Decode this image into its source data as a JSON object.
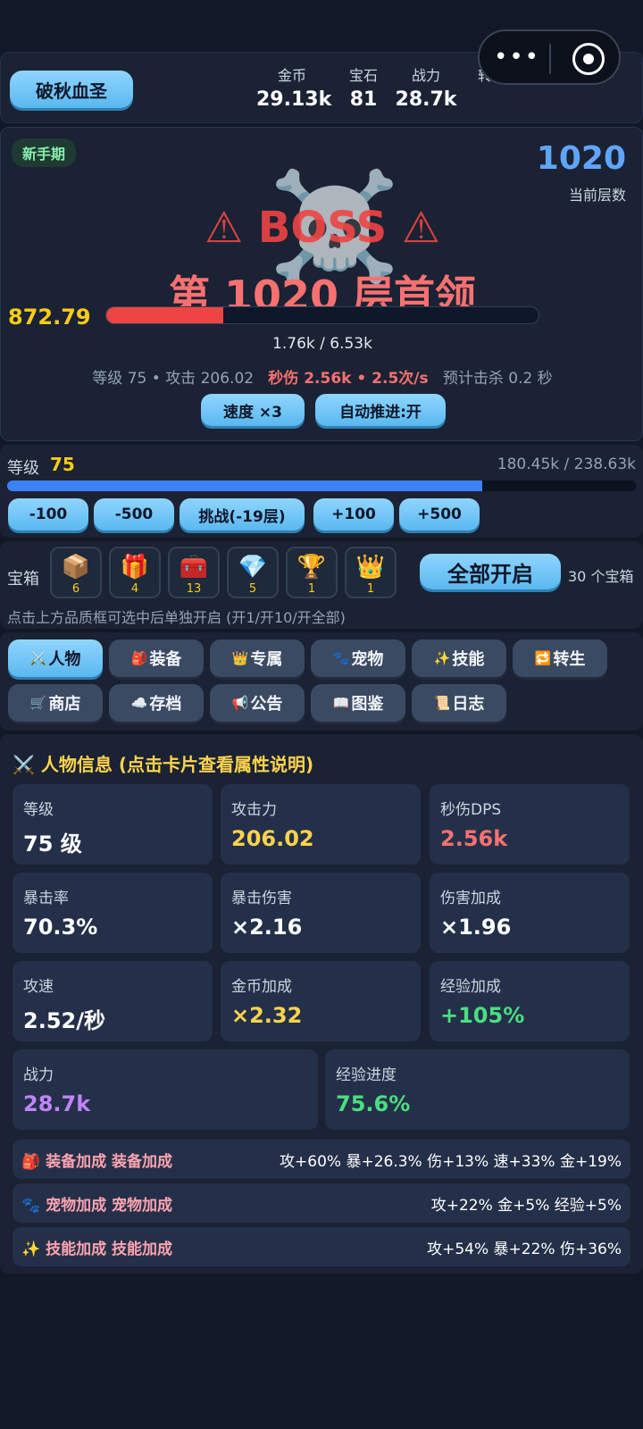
{
  "header": {
    "character_name": "破秋血圣",
    "stats": [
      {
        "label": "金币",
        "value": "29.13k"
      },
      {
        "label": "宝石",
        "value": "81"
      },
      {
        "label": "战力",
        "value": "28.7k"
      },
      {
        "label": "转生点",
        "value": ""
      }
    ]
  },
  "battle": {
    "phase_badge": "新手期",
    "floor_number": "1020",
    "floor_label": "当前层数",
    "boss_banner": "⚠ BOSS ⚠",
    "boss_title": "第 1020 层首领",
    "floating_damage": "872.79",
    "hp_text": "1.76k / 6.53k",
    "hp_fraction": 0.27,
    "info_level": "等级 75",
    "info_sep1": " • ",
    "info_attack": "攻击 206.02",
    "info_dps": "秒伤 2.56k",
    "info_sep2": " • ",
    "info_rate": "2.5次/s",
    "info_kill": "预计击杀 0.2 秒",
    "speed_button": "速度 ×3",
    "auto_button": "自动推进:开"
  },
  "level": {
    "label": "等级",
    "value": "75",
    "exp_text": "180.45k / 238.63k",
    "exp_fraction": 0.756,
    "buttons": [
      "-100",
      "-500",
      "挑战(-19层)",
      "+100",
      "+500"
    ]
  },
  "chests": {
    "label": "宝箱",
    "items": [
      {
        "icon": "📦",
        "icon_name": "crate-icon",
        "count": "6"
      },
      {
        "icon": "🎁",
        "icon_name": "gift-icon",
        "count": "4"
      },
      {
        "icon": "🧰",
        "icon_name": "toolbox-icon",
        "count": "13"
      },
      {
        "icon": "💎",
        "icon_name": "diamond-icon",
        "count": "5"
      },
      {
        "icon": "🏆",
        "icon_name": "trophy-icon",
        "count": "1"
      },
      {
        "icon": "👑",
        "icon_name": "crown-icon",
        "count": "1"
      }
    ],
    "open_all": "全部开启",
    "count_text": "30 个宝箱",
    "hint": "点击上方品质框可选中后单独开启 (开1/开10/开全部)"
  },
  "tabs": [
    {
      "icon": "⚔️",
      "icon_name": "swords-icon",
      "label": "人物",
      "active": true
    },
    {
      "icon": "🎒",
      "icon_name": "backpack-icon",
      "label": "装备",
      "active": false
    },
    {
      "icon": "👑",
      "icon_name": "crown-icon",
      "label": "专属",
      "active": false
    },
    {
      "icon": "🐾",
      "icon_name": "paw-icon",
      "label": "宠物",
      "active": false
    },
    {
      "icon": "✨",
      "icon_name": "sparkles-icon",
      "label": "技能",
      "active": false
    },
    {
      "icon": "🔁",
      "icon_name": "repeat-icon",
      "label": "转生",
      "active": false
    },
    {
      "icon": "🛒",
      "icon_name": "cart-icon",
      "label": "商店",
      "active": false
    },
    {
      "icon": "☁️",
      "icon_name": "cloud-icon",
      "label": "存档",
      "active": false
    },
    {
      "icon": "📢",
      "icon_name": "megaphone-icon",
      "label": "公告",
      "active": false
    },
    {
      "icon": "📖",
      "icon_name": "book-icon",
      "label": "图鉴",
      "active": false
    },
    {
      "icon": "📜",
      "icon_name": "scroll-icon",
      "label": "日志",
      "active": false
    }
  ],
  "character": {
    "title": "⚔️ 人物信息 (点击卡片查看属性说明)",
    "cards": [
      {
        "label": "等级",
        "value": "75 级",
        "color": "#ffffff"
      },
      {
        "label": "攻击力",
        "value": "206.02",
        "color": "#fcd34d"
      },
      {
        "label": "秒伤DPS",
        "value": "2.56k",
        "color": "#f87171"
      },
      {
        "label": "暴击率",
        "value": "70.3%",
        "color": "#ffffff"
      },
      {
        "label": "暴击伤害",
        "value": "×2.16",
        "color": "#ffffff"
      },
      {
        "label": "伤害加成",
        "value": "×1.96",
        "color": "#ffffff"
      },
      {
        "label": "攻速",
        "value": "2.52/秒",
        "color": "#ffffff"
      },
      {
        "label": "金币加成",
        "value": "×2.32",
        "color": "#fcd34d"
      },
      {
        "label": "经验加成",
        "value": "+105%",
        "color": "#4ade80"
      },
      {
        "label": "战力",
        "value": "28.7k",
        "color": "#c084fc"
      },
      {
        "label": "经验进度",
        "value": "75.6%",
        "color": "#4ade80"
      }
    ],
    "bonus_rows": [
      {
        "label": "🎒 装备加成 装备加成",
        "value": "攻+60% 暴+26.3% 伤+13% 速+33% 金+19%"
      },
      {
        "label": "🐾 宠物加成 宠物加成",
        "value": "攻+22% 金+5% 经验+5%"
      },
      {
        "label": "✨ 技能加成 技能加成",
        "value": "攻+54% 暴+22% 伤+36%"
      }
    ]
  }
}
